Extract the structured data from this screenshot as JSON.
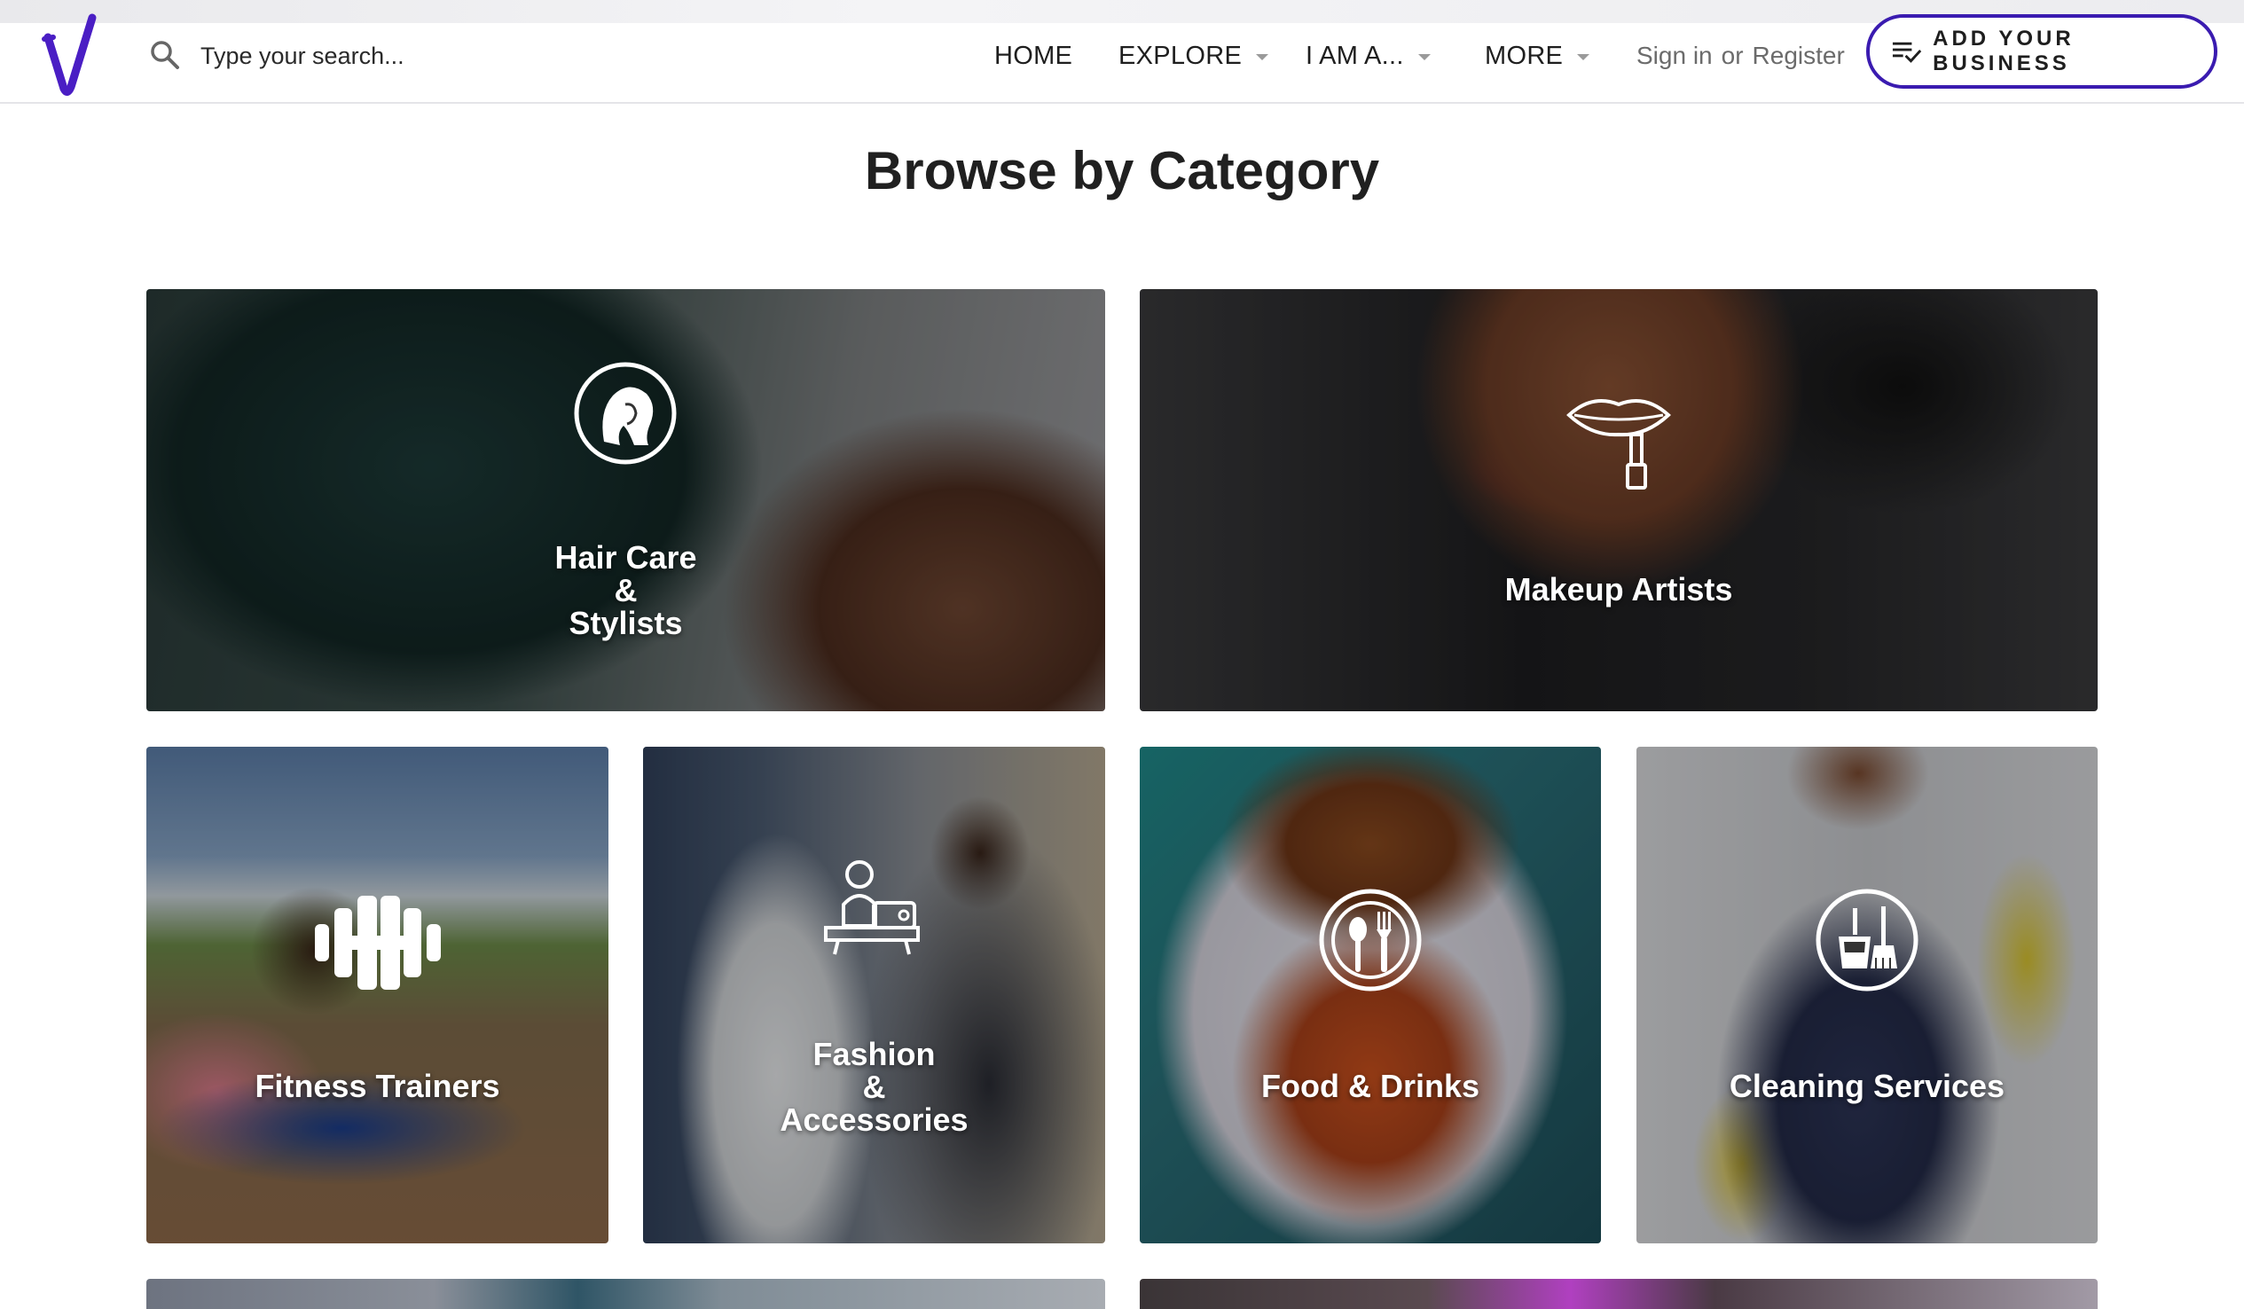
{
  "brand": {
    "accent": "#3a1bb0",
    "logo_color": "#4a1ec4"
  },
  "search": {
    "placeholder": "Type your search...",
    "icon": "search-icon"
  },
  "nav": {
    "items": [
      {
        "label": "HOME",
        "has_dropdown": false
      },
      {
        "label": "EXPLORE",
        "has_dropdown": true
      },
      {
        "label": "I AM A...",
        "has_dropdown": true
      },
      {
        "label": "MORE",
        "has_dropdown": true
      }
    ],
    "sign_in": "Sign in",
    "or": "or",
    "register": "Register",
    "add_business": "ADD YOUR BUSINESS",
    "add_business_icon": "playlist-add-check-icon"
  },
  "page": {
    "title": "Browse by Category"
  },
  "categories": [
    {
      "title": "Hair Care\n&\nStylists",
      "icon": "hair-profile-icon"
    },
    {
      "title": "Makeup Artists",
      "icon": "lipstick-lips-icon"
    },
    {
      "title": "Fitness Trainers",
      "icon": "dumbbell-icon"
    },
    {
      "title": "Fashion\n&\nAccessories",
      "icon": "tailor-sewing-icon"
    },
    {
      "title": "Food & Drinks",
      "icon": "plate-fork-icon"
    },
    {
      "title": "Cleaning Services",
      "icon": "bucket-broom-icon"
    }
  ]
}
